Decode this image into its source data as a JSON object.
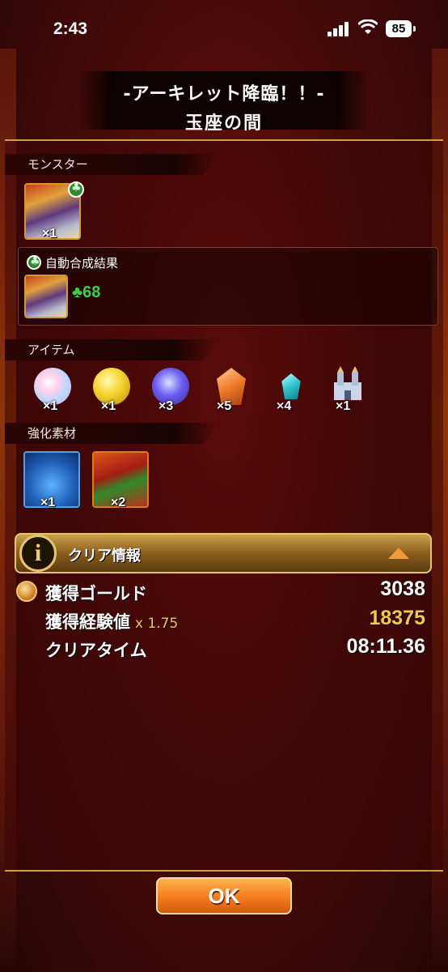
{
  "status_bar": {
    "time": "2:43",
    "battery": "85"
  },
  "header": {
    "title": "-アーキレット降臨！！-",
    "subtitle": "玉座の間"
  },
  "sections": {
    "monster": {
      "label": "モンスター",
      "count": "×1",
      "auto_label": "自動合成結果",
      "auto_value": "68",
      "auto_icon": "clover-icon"
    },
    "items": {
      "label": "アイテム",
      "list": [
        {
          "icon": "rainbow-orb-icon",
          "count": "×1"
        },
        {
          "icon": "gold-orb-icon",
          "count": "×1"
        },
        {
          "icon": "purple-crystal-icon",
          "count": "×3"
        },
        {
          "icon": "orange-crystal-icon",
          "count": "×5"
        },
        {
          "icon": "teal-gem-icon",
          "count": "×4"
        },
        {
          "icon": "castle-icon",
          "count": "×1"
        }
      ]
    },
    "materials": {
      "label": "強化素材",
      "list": [
        {
          "icon": "blue-material-icon",
          "count": "×1"
        },
        {
          "icon": "red-material-icon",
          "count": "×2"
        }
      ]
    }
  },
  "clear_info": {
    "label": "クリア情報",
    "gold_label": "獲得ゴールド",
    "gold_value": "3038",
    "exp_label": "獲得経験値",
    "exp_multiplier": "x 1.75",
    "exp_value": "18375",
    "time_label": "クリアタイム",
    "time_value": "08:11.36"
  },
  "ok_button": "OK",
  "colors": {
    "accent_gold": "#f5c84a",
    "clover_green": "#3dd23d",
    "button_orange": "#f57b1d"
  }
}
